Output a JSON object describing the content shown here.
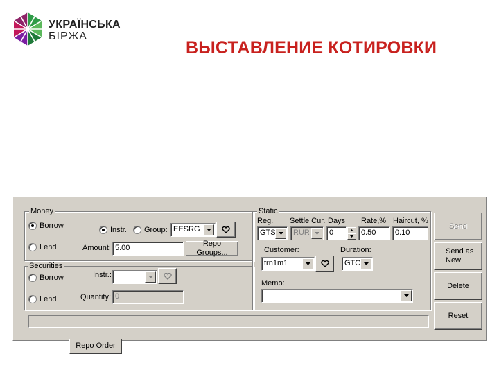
{
  "brand": {
    "line1": "УКРАЇНСЬКА",
    "line2": "БІРЖА"
  },
  "slide_title": "ВЫСТАВЛЕНИЕ КОТИРОВКИ",
  "colors": {
    "title": "#c8211e",
    "dialog_bg": "#d4d0c8",
    "logo_green": "#2e9b47",
    "logo_magenta": "#c2185b"
  },
  "money": {
    "legend": "Money",
    "borrow_label": "Borrow",
    "borrow_checked": true,
    "lend_label": "Lend",
    "lend_checked": false,
    "instr_label": "Instr.",
    "instr_checked": true,
    "group_label": "Group:",
    "group_checked": false,
    "group_value": "EESRG",
    "amount_label": "Amount:",
    "amount_value": "5.00",
    "repo_groups_button": "Repo Groups..."
  },
  "securities": {
    "legend": "Securities",
    "borrow_label": "Borrow",
    "lend_label": "Lend",
    "instr_label": "Instr.:",
    "instr_value": "",
    "quantity_label": "Quantity:",
    "quantity_value": "0"
  },
  "static": {
    "legend": "Static",
    "reg_label": "Reg.",
    "reg_value": "GTS",
    "settle_label": "Settle Cur.",
    "settle_value": "RUR",
    "days_label": "Days",
    "days_value": "0",
    "rate_label": "Rate,%",
    "rate_value": "0.50",
    "haircut_label": "Haircut, %",
    "haircut_value": "0.10",
    "customer_label": "Customer:",
    "customer_value": "trn1m1",
    "duration_label": "Duration:",
    "duration_value": "GTC",
    "memo_label": "Memo:",
    "memo_value": ""
  },
  "actions": {
    "send": "Send",
    "send_as_new": "Send as\nNew",
    "delete": "Delete",
    "reset": "Reset"
  },
  "tabs": {
    "active": "Repo Order"
  },
  "icons": {
    "favorites": "heart-icon",
    "dropdown": "chevron-down-icon"
  }
}
